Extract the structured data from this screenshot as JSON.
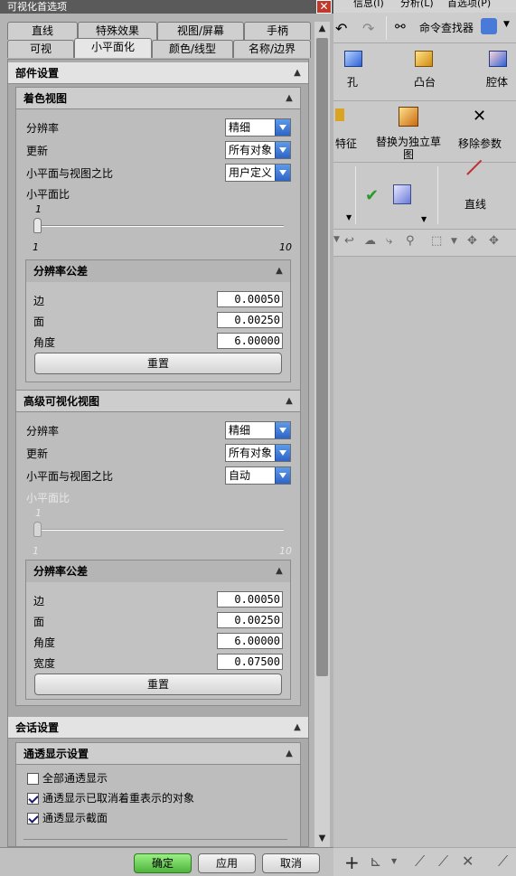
{
  "dialog": {
    "title": "可视化首选项",
    "close_glyph": "✕",
    "tabs_row1": [
      "直线",
      "特殊效果",
      "视图/屏幕",
      "手柄"
    ],
    "tabs_row2": [
      "可视",
      "小平面化",
      "颜色/线型",
      "名称/边界"
    ],
    "active_tab": "小平面化",
    "part_settings": {
      "title": "部件设置",
      "shaded_view": {
        "title": "着色视图",
        "resolution_label": "分辨率",
        "resolution_value": "精细",
        "update_label": "更新",
        "update_value": "所有对象",
        "ratio_label": "小平面与视图之比",
        "ratio_value": "用户定义",
        "facet_ratio_label": "小平面比",
        "slider_value": "1",
        "slider_min": "1",
        "slider_max": "10",
        "tolerance": {
          "title": "分辨率公差",
          "edge_label": "边",
          "edge_value": "0.00050",
          "face_label": "面",
          "face_value": "0.00250",
          "angle_label": "角度",
          "angle_value": "6.00000",
          "reset_label": "重置"
        }
      },
      "advanced_view": {
        "title": "高级可视化视图",
        "resolution_label": "分辨率",
        "resolution_value": "精细",
        "update_label": "更新",
        "update_value": "所有对象",
        "ratio_label": "小平面与视图之比",
        "ratio_value": "自动",
        "facet_ratio_label": "小平面比",
        "slider_value": "1",
        "slider_min": "1",
        "slider_max": "10",
        "tolerance": {
          "title": "分辨率公差",
          "edge_label": "边",
          "edge_value": "0.00050",
          "face_label": "面",
          "face_value": "0.00250",
          "angle_label": "角度",
          "angle_value": "6.00000",
          "width_label": "宽度",
          "width_value": "0.07500",
          "reset_label": "重置"
        }
      }
    },
    "session_settings": {
      "title": "会话设置",
      "see_through": {
        "title": "通透显示设置",
        "all_label": "全部通透显示",
        "all_checked": false,
        "cancel_label": "通透显示已取消着重表示的对象",
        "cancel_checked": true,
        "section_label": "通透显示截面",
        "section_checked": true
      }
    },
    "buttons": {
      "ok": "确定",
      "apply": "应用",
      "cancel": "取消"
    }
  },
  "app": {
    "menu": [
      "信息(I)",
      "分析(L)",
      "首选项(P)"
    ],
    "command_finder": "命令查找器",
    "ribbon": {
      "hole": "孔",
      "boss": "凸台",
      "pocket": "腔体",
      "feature": "特征",
      "replace_sketch": "替换为独立草图",
      "remove_params": "移除参数",
      "line": "直线"
    },
    "colors": {
      "accent_blue": "#2d64c8",
      "ok_green": "#6dcc5a"
    }
  }
}
